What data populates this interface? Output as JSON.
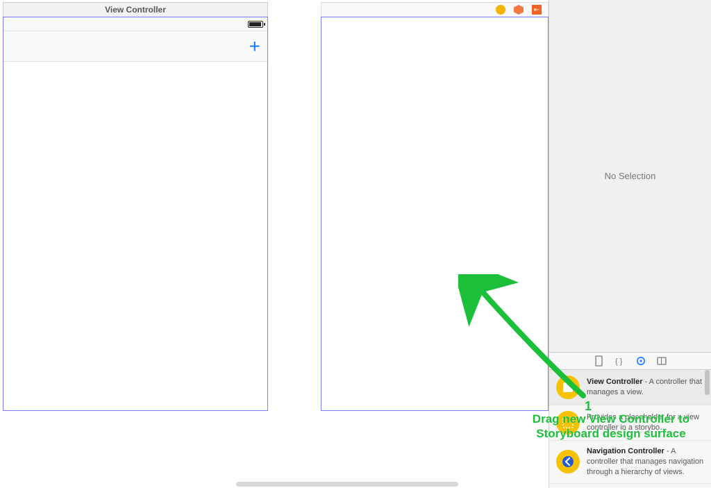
{
  "canvas": {
    "scene_left_title": "View Controller"
  },
  "inspector": {
    "empty_text": "No Selection"
  },
  "library": {
    "items": [
      {
        "title": "View Controller",
        "desc": " - A controller that manages a view."
      },
      {
        "title": "",
        "desc": "Provides a placeholder for a view controller in a storybo…"
      },
      {
        "title": "Navigation Controller",
        "desc": " - A controller that manages navigation through a hierarchy of views."
      }
    ]
  },
  "annotation": {
    "step": "1",
    "text": "Drag new View Controller to Storyboard design surface"
  }
}
